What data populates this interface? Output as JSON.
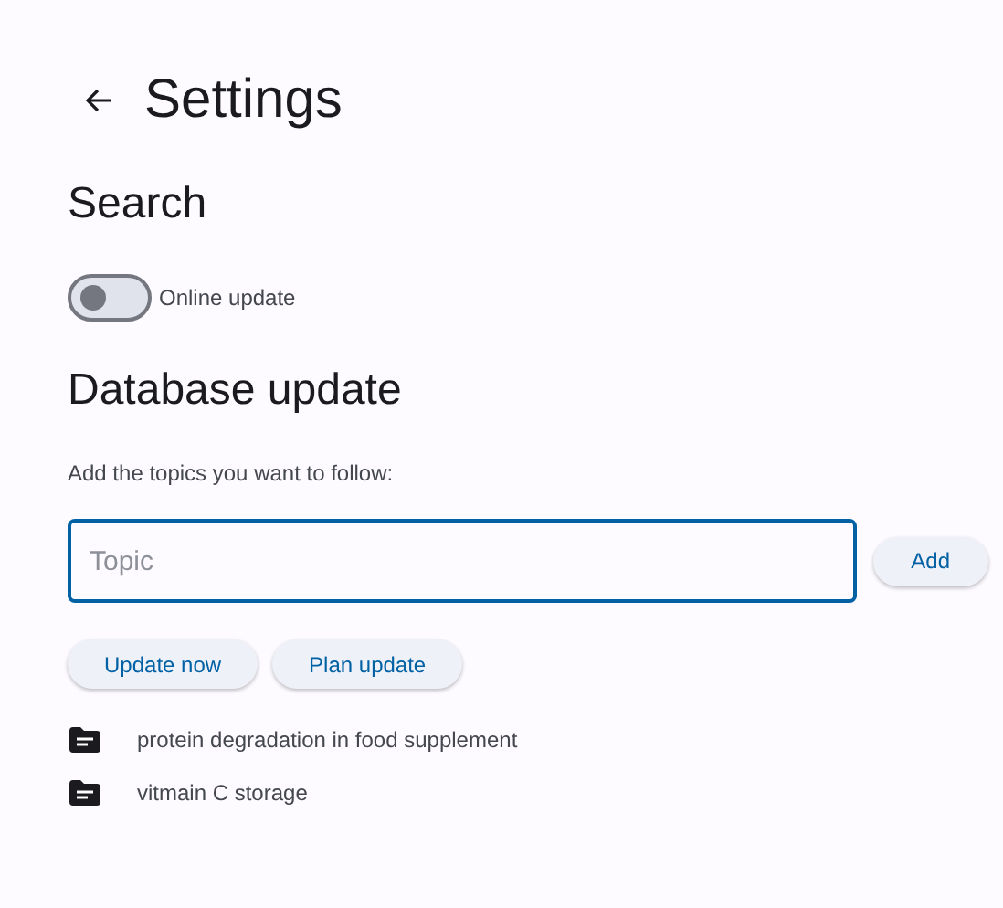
{
  "header": {
    "title": "Settings"
  },
  "search": {
    "heading": "Search",
    "toggle": {
      "label": "Online update",
      "on": false
    }
  },
  "database_update": {
    "heading": "Database update",
    "hint": "Add the topics you want to follow:",
    "topic_field": {
      "placeholder": "Topic",
      "focused": true
    },
    "add_button": "Add",
    "buttons": [
      "Update now",
      "Plan update"
    ],
    "topics": [
      "protein degradation in food supplement",
      "vitmain C storage"
    ]
  }
}
